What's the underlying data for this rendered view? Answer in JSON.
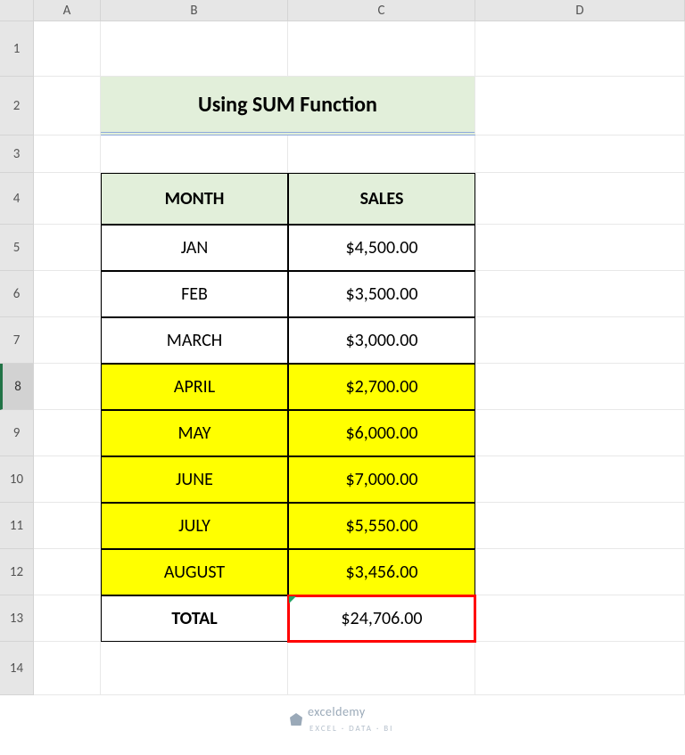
{
  "columns": [
    "A",
    "B",
    "C",
    "D"
  ],
  "rows": [
    "1",
    "2",
    "3",
    "4",
    "5",
    "6",
    "7",
    "8",
    "9",
    "10",
    "11",
    "12",
    "13",
    "14"
  ],
  "title": "Using SUM Function",
  "headers": {
    "month": "MONTH",
    "sales": "SALES"
  },
  "data": [
    {
      "month": "JAN",
      "sales": "$4,500.00",
      "highlight": false
    },
    {
      "month": "FEB",
      "sales": "$3,500.00",
      "highlight": false
    },
    {
      "month": "MARCH",
      "sales": "$3,000.00",
      "highlight": false
    },
    {
      "month": "APRIL",
      "sales": "$2,700.00",
      "highlight": true
    },
    {
      "month": "MAY",
      "sales": "$6,000.00",
      "highlight": true
    },
    {
      "month": "JUNE",
      "sales": "$7,000.00",
      "highlight": true
    },
    {
      "month": "JULY",
      "sales": "$5,550.00",
      "highlight": true
    },
    {
      "month": "AUGUST",
      "sales": "$3,456.00",
      "highlight": true
    }
  ],
  "total": {
    "label": "TOTAL",
    "value": "$24,706.00"
  },
  "selected_row": "8",
  "watermark": {
    "brand": "exceldemy",
    "tagline": "EXCEL · DATA · BI"
  }
}
